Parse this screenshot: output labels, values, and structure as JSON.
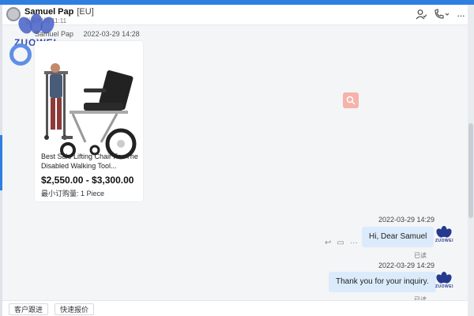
{
  "header": {
    "contact_name": "Samuel Pap",
    "region": "[EU]",
    "status": "当前时间 11:11",
    "icons": [
      "contact-icon",
      "phone-icon",
      "more-icon"
    ]
  },
  "logo": {
    "text": "ZUOWEI"
  },
  "messages": {
    "incoming": {
      "sender": "Samuel Pap",
      "time": "2022-03-29 14:28",
      "product": {
        "title": "Best Sale Lifting Chair For The Disabled Walking Tool...",
        "price": "$2,550.00 - $3,300.00",
        "moq": "最小订购量: 1 Piece"
      }
    },
    "outgoing": [
      {
        "time": "2022-03-29 14:29",
        "text": "Hi, Dear Samuel",
        "status": "已读"
      },
      {
        "time": "2022-03-29 14:29",
        "text": "Thank you for your inquiry.",
        "status": "已读"
      }
    ],
    "avatar_label": "ZUOWEI"
  },
  "bottom": {
    "chips": [
      "客户跟进",
      "快速报价"
    ]
  },
  "colors": {
    "accent": "#2f7fe0",
    "bubble": "#dcebfb",
    "brand": "#3a4fb0"
  }
}
